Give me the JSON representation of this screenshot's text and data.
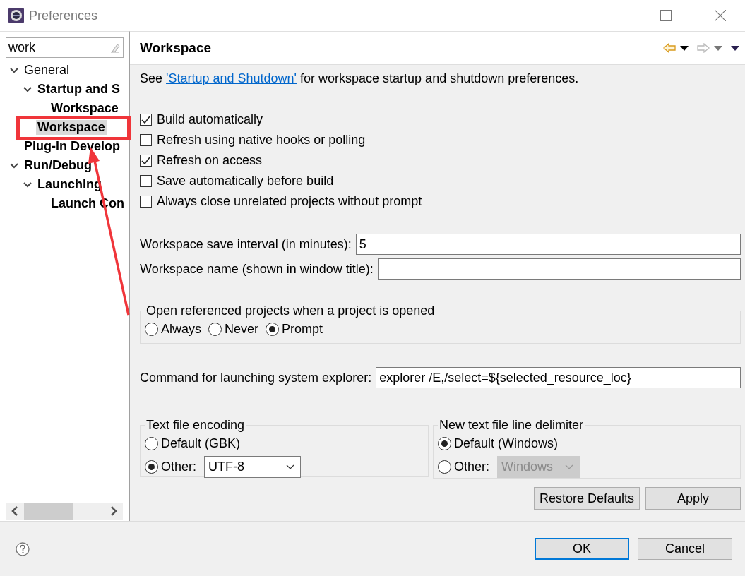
{
  "window": {
    "title": "Preferences"
  },
  "sidebar": {
    "filter": {
      "value": "work"
    },
    "tree": [
      {
        "label": "General",
        "bold": false,
        "selected": false,
        "expanded": true,
        "children": [
          {
            "label": "Startup and S",
            "bold": true,
            "selected": false,
            "expanded": true,
            "children": [
              {
                "label": "Workspace",
                "bold": true,
                "selected": false
              }
            ]
          },
          {
            "label": "Workspace",
            "bold": true,
            "selected": true
          }
        ]
      },
      {
        "label": "Plug-in Develop",
        "bold": true,
        "selected": false
      },
      {
        "label": "Run/Debug",
        "bold": true,
        "selected": false,
        "expanded": true,
        "children": [
          {
            "label": "Launching",
            "bold": true,
            "selected": false,
            "expanded": true,
            "children": [
              {
                "label": "Launch Con",
                "bold": true,
                "selected": false
              }
            ]
          }
        ]
      }
    ]
  },
  "page": {
    "title": "Workspace",
    "intro": {
      "before": "See ",
      "link": "'Startup and Shutdown'",
      "after": " for workspace startup and shutdown preferences."
    },
    "checkboxes": [
      {
        "label": "Build automatically",
        "checked": true
      },
      {
        "label": "Refresh using native hooks or polling",
        "checked": false
      },
      {
        "label": "Refresh on access",
        "checked": true
      },
      {
        "label": "Save automatically before build",
        "checked": false
      },
      {
        "label": "Always close unrelated projects without prompt",
        "checked": false
      }
    ],
    "fields": [
      {
        "label": "Workspace save interval (in minutes):",
        "value": "5"
      },
      {
        "label": "Workspace name (shown in window title):"
      }
    ],
    "open_projects": {
      "title": "Open referenced projects when a project is opened",
      "options": [
        {
          "label": "Always",
          "selected": false
        },
        {
          "label": "Never",
          "selected": false
        },
        {
          "label": "Prompt",
          "selected": true
        }
      ]
    },
    "command": {
      "label": "Command for launching system explorer:",
      "value": "explorer /E,/select=${selected_resource_loc}"
    },
    "encoding": {
      "title": "Text file encoding",
      "options": [
        {
          "label": "Default (GBK)",
          "selected": false
        },
        {
          "label": "Other:",
          "selected": true,
          "combo": {
            "value": "UTF-8",
            "disabled": false
          }
        }
      ]
    },
    "line_delimiter": {
      "title": "New text file line delimiter",
      "options": [
        {
          "label": "Default (Windows)",
          "selected": true
        },
        {
          "label": "Other:",
          "selected": false,
          "combo": {
            "value": "Windows",
            "disabled": true
          }
        }
      ]
    },
    "buttons": [
      {
        "label": "Restore Defaults"
      },
      {
        "label": "Apply"
      }
    ]
  },
  "footer": {
    "buttons": [
      {
        "label": "OK",
        "default": true
      },
      {
        "label": "Cancel",
        "default": false
      }
    ]
  }
}
